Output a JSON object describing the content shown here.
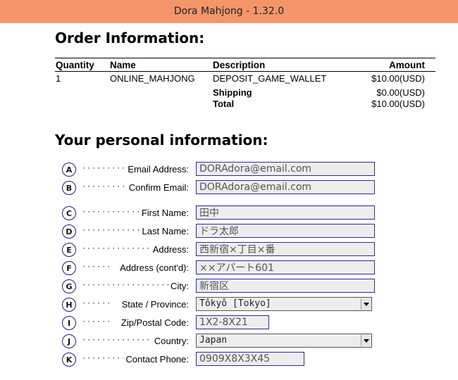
{
  "window": {
    "title": "Dora Mahjong - 1.32.0"
  },
  "order": {
    "heading": "Order Information:",
    "columns": {
      "quantity": "Quantity",
      "name": "Name",
      "description": "Description",
      "amount": "Amount"
    },
    "items": [
      {
        "quantity": "1",
        "name": "ONLINE_MAHJONG",
        "description": "DEPOSIT_GAME_WALLET",
        "amount": "$10.00(USD)"
      }
    ],
    "shipping": {
      "label": "Shipping",
      "amount": "$0.00(USD)"
    },
    "total": {
      "label": "Total",
      "amount": "$10.00(USD)"
    }
  },
  "personal": {
    "heading": "Your personal information:",
    "fields": [
      {
        "badge": "A",
        "leader": "·········",
        "label": "Email Address:",
        "value": "DORAdora@email.com"
      },
      {
        "badge": "B",
        "leader": "·········",
        "label": "Confirm Email:",
        "value": "DORAdora@email.com"
      },
      {
        "badge": "C",
        "leader": "············",
        "label": "First Name:",
        "value": "田中"
      },
      {
        "badge": "D",
        "leader": "············",
        "label": "Last Name:",
        "value": "ドラ太郎"
      },
      {
        "badge": "E",
        "leader": "················",
        "label": "Address:",
        "value": "西新宿×丁目×番"
      },
      {
        "badge": "F",
        "leader": "······",
        "label": "Address (cont'd):",
        "value": "××アパート601"
      },
      {
        "badge": "G",
        "leader": "··················",
        "label": "City:",
        "value": "新宿区"
      },
      {
        "badge": "H",
        "leader": "······",
        "label": "State / Province:",
        "value": "Tôkyô [Tokyo]"
      },
      {
        "badge": "I",
        "leader": "······",
        "label": "Zip/Postal Code:",
        "value": "1X2-8X21"
      },
      {
        "badge": "J",
        "leader": "················",
        "label": "Country:",
        "value": "Japan"
      },
      {
        "badge": "K",
        "leader": "·········",
        "label": "Contact Phone:",
        "value": "0909X8X3X45"
      }
    ]
  }
}
